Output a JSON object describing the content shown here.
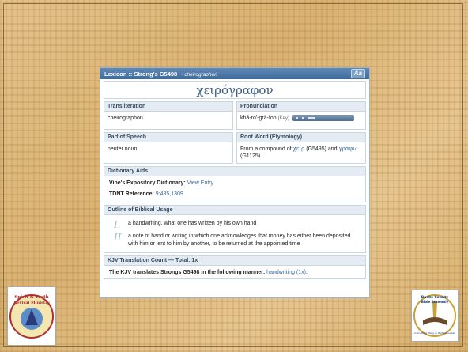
{
  "window": {
    "title": "Lexicon :: Strong's G5498",
    "subtitle": "cheirographon",
    "font_button": "Aa"
  },
  "headword": "χειρόγραφον",
  "transliteration": {
    "label": "Transliteration",
    "value": "cheirographon"
  },
  "pronunciation": {
    "label": "Pronunciation",
    "value": "khā-ro'-grä-fon",
    "key": "(Key)"
  },
  "part_of_speech": {
    "label": "Part of Speech",
    "value": "neuter noun"
  },
  "root_word": {
    "label": "Root Word (Etymology)",
    "prefix": "From a compound of",
    "word1": "χείρ",
    "ref1": "(G5495)",
    "and": "and",
    "word2": "γράφω",
    "ref2": "(G1125)"
  },
  "dictionary_aids": {
    "label": "Dictionary Aids",
    "vines_label": "Vine's Expository Dictionary:",
    "vines_link": "View Entry",
    "tdnt_label": "TDNT Reference:",
    "tdnt_value": "9:435,1309"
  },
  "outline": {
    "label": "Outline of Biblical Usage",
    "items": [
      {
        "num": "I.",
        "text": "a handwriting, what one has written by his own hand"
      },
      {
        "num": "II.",
        "text": "a note of hand or writing in which one acknowledges that money has either been deposited with him or lent to him by another, to be returned at the appointed time"
      }
    ]
  },
  "kjv": {
    "label": "KJV Translation Count — Total: 1x",
    "text": "The KJV translates Strongs G5498 in the following manner:",
    "link": "handwriting (1x)",
    "end": "."
  },
  "logos": {
    "left_top": "Spirit & Truth",
    "left_mid": "Revival Ministry",
    "right_top": "Bucks County",
    "right_mid": "Bible Assembly",
    "right_bottom": "Instructing Many in Righteousness"
  },
  "colors": {
    "titlebar": "#4a77a6",
    "header_bg": "#e4ebf2",
    "link": "#3a6aa0",
    "wood": "#dcb676"
  }
}
